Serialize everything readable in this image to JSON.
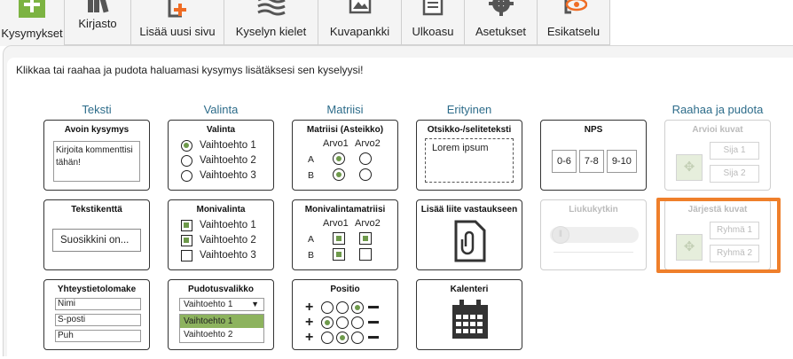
{
  "toolbar": {
    "items": [
      {
        "label": "Kysymykset",
        "icon": "plus-icon"
      },
      {
        "label": "Kirjasto",
        "icon": "books-icon"
      },
      {
        "label": "Lisää uusi sivu",
        "icon": "add-page-icon"
      },
      {
        "label": "Kyselyn kielet",
        "icon": "waves-icon"
      },
      {
        "label": "Kuvapankki",
        "icon": "image-icon"
      },
      {
        "label": "Ulkoasu",
        "icon": "layout-icon"
      },
      {
        "label": "Asetukset",
        "icon": "gear-icon"
      },
      {
        "label": "Esikatselu",
        "icon": "preview-eye-icon"
      }
    ]
  },
  "hint": "Klikkaa tai raahaa ja pudota haluamasi kysymys lisätäksesi sen kyselyysi!",
  "columns": [
    "Teksti",
    "Valinta",
    "Matriisi",
    "Erityinen",
    "Raahaa ja pudota"
  ],
  "cards": {
    "open_question": {
      "title": "Avoin kysymys",
      "text": "Kirjoita kommenttisi tähän!"
    },
    "choice": {
      "title": "Valinta",
      "options": [
        "Vaihtoehto 1",
        "Vaihtoehto 2",
        "Vaihtoehto 3"
      ]
    },
    "matrix": {
      "title": "Matriisi (Asteikko)",
      "cols": [
        "Arvo1",
        "Arvo2"
      ],
      "rows": [
        "A",
        "B"
      ]
    },
    "heading": {
      "title": "Otsikko-/seliteteksti",
      "text": "Lorem ipsum"
    },
    "nps": {
      "title": "NPS",
      "ranges": [
        "0-6",
        "7-8",
        "9-10"
      ]
    },
    "rate_images": {
      "title": "Arvioi kuvat",
      "slots": [
        "Sija 1",
        "Sija 2"
      ]
    },
    "text_field": {
      "title": "Tekstikenttä",
      "value": "Suosikkini on..."
    },
    "multi": {
      "title": "Monivalinta",
      "options": [
        "Vaihtoehto 1",
        "Vaihtoehto 2",
        "Vaihtoehto 3"
      ]
    },
    "multi_matrix": {
      "title": "Monivalintamatriisi",
      "cols": [
        "Arvo1",
        "Arvo2"
      ],
      "rows": [
        "A",
        "B"
      ]
    },
    "attachment": {
      "title": "Lisää liite vastaukseen"
    },
    "slider": {
      "title": "Liukukytkin"
    },
    "sort_images": {
      "title": "Järjestä kuvat",
      "groups": [
        "Ryhmä 1",
        "Ryhmä 2"
      ]
    },
    "contact": {
      "title": "Yhteystietolomake",
      "fields": [
        "Nimi",
        "S-posti",
        "Puh"
      ]
    },
    "dropdown": {
      "title": "Pudotusvalikko",
      "selected": "Vaihtoehto 1",
      "options": [
        "Vaihtoehto 1",
        "Vaihtoehto 2"
      ]
    },
    "position": {
      "title": "Positio"
    },
    "calendar": {
      "title": "Kalenteri"
    }
  },
  "colors": {
    "accent_green": "#6e9a4b",
    "heading_blue": "#2d6c8a",
    "highlight_orange": "#ef7f2b"
  }
}
